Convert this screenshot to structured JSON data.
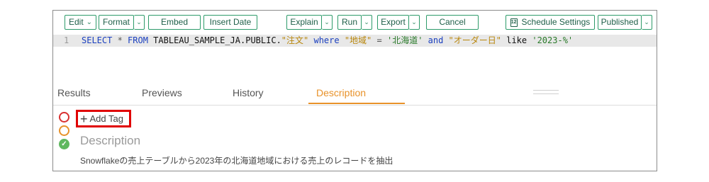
{
  "toolbar": {
    "edit": "Edit",
    "format": "Format",
    "embed": "Embed",
    "insert_date": "Insert Date",
    "explain": "Explain",
    "run": "Run",
    "export": "Export",
    "cancel": "Cancel",
    "schedule_settings": "Schedule Settings",
    "calendar_day": "12",
    "published": "Published"
  },
  "editor": {
    "line_number": "1",
    "tokens": {
      "select": "SELECT",
      "star": " * ",
      "from": "FROM",
      "table": " TABLEAU_SAMPLE_JA.PUBLIC.",
      "table_quoted": "\"注文\"",
      "where": " where ",
      "col1": "\"地域\"",
      "eq": " = ",
      "val1": "'北海道'",
      "and": " and ",
      "col2": "\"オーダー日\"",
      "like": " like ",
      "val2": "'2023-%'"
    }
  },
  "tabs": {
    "results": "Results",
    "previews": "Previews",
    "history": "History",
    "description": "Description",
    "active": "Description"
  },
  "description_panel": {
    "add_tag": "Add Tag",
    "title": "Description",
    "text": "Snowflakeの売上テーブルから2023年の北海道地域における売上のレコードを抽出"
  },
  "colors": {
    "accent_green": "#2e9b6a",
    "active_tab": "#e8922a",
    "highlight_red": "#e00000"
  }
}
